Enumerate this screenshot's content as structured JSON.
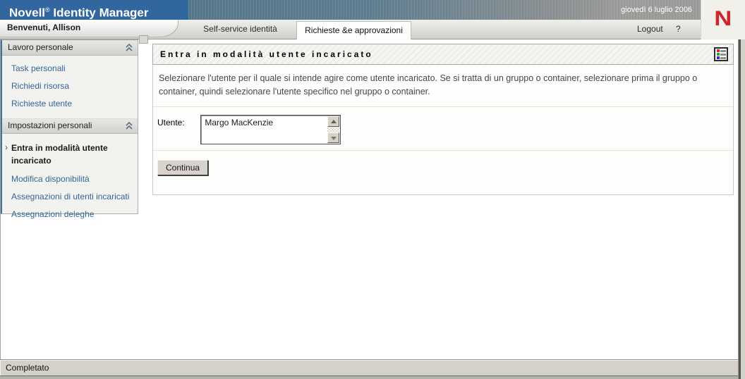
{
  "header": {
    "brand": {
      "novell": "Novell",
      "reg": "®",
      "rest": " Identity Manager"
    },
    "date": "giovedì 6 luglio 2006",
    "welcome": "Benvenuti, Allison",
    "logo_letter": "N",
    "tabs": [
      {
        "label": "Self-service identità",
        "active": false
      },
      {
        "label": "Richieste &e approvazioni",
        "active": true
      }
    ],
    "logout_label": "Logout",
    "help_label": "?"
  },
  "sidebar": {
    "active_marker": "›",
    "sections": [
      {
        "title": "Lavoro personale",
        "items": [
          "Task personali",
          "Richiedi risorsa",
          "Richieste utente"
        ]
      },
      {
        "title": "Impostazioni personali",
        "items": [
          "Entra in modalità utente incaricato",
          "Modifica disponibilità",
          "Assegnazioni di utenti incaricati",
          "Assegnazioni deleghe"
        ],
        "active_item_index": 0
      }
    ]
  },
  "main": {
    "title": "Entra in modalità utente incaricato",
    "description": "Selezionare l'utente per il quale si intende agire come utente incaricato. Se si tratta di un gruppo o container, selezionare prima il gruppo o container, quindi selezionare l'utente specifico nel gruppo o container.",
    "form": {
      "user_label": "Utente:",
      "user_value": "Margo MacKenzie",
      "continue_label": "Continua"
    }
  },
  "statusbar": {
    "text": "Completato"
  },
  "colors": {
    "header_blue": "#31669e",
    "texture_teal": "#5e7e90",
    "novell_red": "#d2232a",
    "link_blue": "#336699",
    "panel_border": "#a6a6a2",
    "status_gray": "#d5d1c8"
  }
}
